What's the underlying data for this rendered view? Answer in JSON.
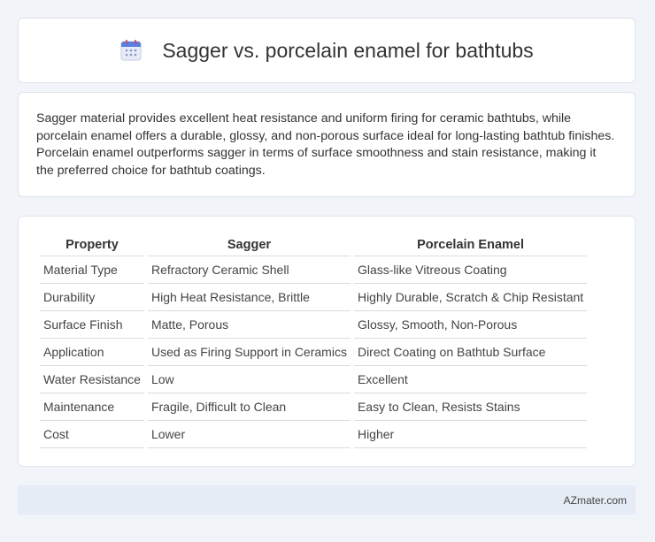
{
  "header": {
    "title": "Sagger vs. porcelain enamel for bathtubs",
    "icon": "calendar-icon",
    "icon_colors": {
      "top": "#5b7fe0",
      "body": "#e8ecf7",
      "dots": "#8a97c9"
    }
  },
  "summary": {
    "text": "Sagger material provides excellent heat resistance and uniform firing for ceramic bathtubs, while porcelain enamel offers a durable, glossy, and non-porous surface ideal for long-lasting bathtub finishes. Porcelain enamel outperforms sagger in terms of surface smoothness and stain resistance, making it the preferred choice for bathtub coatings."
  },
  "table": {
    "headers": [
      "Property",
      "Sagger",
      "Porcelain Enamel"
    ],
    "rows": [
      [
        "Material Type",
        "Refractory Ceramic Shell",
        "Glass-like Vitreous Coating"
      ],
      [
        "Durability",
        "High Heat Resistance, Brittle",
        "Highly Durable, Scratch & Chip Resistant"
      ],
      [
        "Surface Finish",
        "Matte, Porous",
        "Glossy, Smooth, Non-Porous"
      ],
      [
        "Application",
        "Used as Firing Support in Ceramics",
        "Direct Coating on Bathtub Surface"
      ],
      [
        "Water Resistance",
        "Low",
        "Excellent"
      ],
      [
        "Maintenance",
        "Fragile, Difficult to Clean",
        "Easy to Clean, Resists Stains"
      ],
      [
        "Cost",
        "Lower",
        "Higher"
      ]
    ]
  },
  "footer": {
    "text": "AZmater.com"
  }
}
